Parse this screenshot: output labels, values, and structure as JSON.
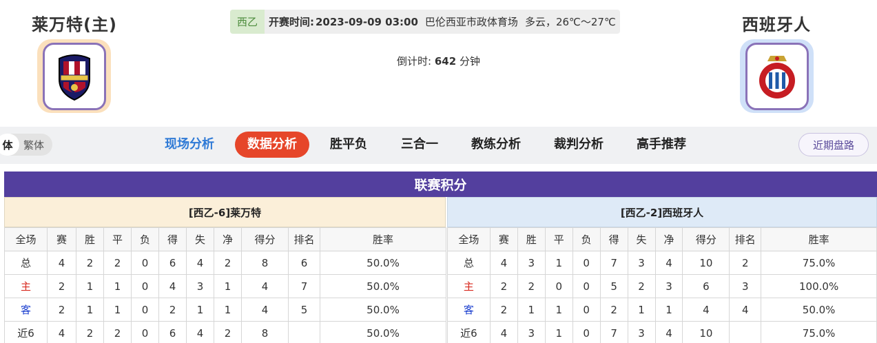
{
  "match": {
    "home_name": "莱万特(主)",
    "away_name": "西班牙人",
    "league": "西乙",
    "kickoff_label": "开赛时间:",
    "kickoff_time": "2023-09-09 03:00",
    "venue": "巴伦西亚市政体育场",
    "weather": "多云，26℃～27℃",
    "countdown_label": "倒计时:",
    "countdown_value": "642",
    "countdown_unit": "分钟"
  },
  "nav": {
    "lang_simplified": "简体",
    "lang_simplified_visible": "体",
    "lang_traditional": "繁体",
    "tabs": [
      "现场分析",
      "数据分析",
      "胜平负",
      "三合一",
      "教练分析",
      "裁判分析",
      "高手推荐"
    ],
    "recent_button": "近期盘路"
  },
  "standings": {
    "title": "联赛积分",
    "columns": [
      "全场",
      "赛",
      "胜",
      "平",
      "负",
      "得",
      "失",
      "净",
      "得分",
      "排名",
      "胜率"
    ],
    "home": {
      "header": "[西乙-6]莱万特",
      "rows": [
        [
          "总",
          "4",
          "2",
          "2",
          "0",
          "6",
          "4",
          "2",
          "8",
          "6",
          "50.0%"
        ],
        [
          "主",
          "2",
          "1",
          "1",
          "0",
          "4",
          "3",
          "1",
          "4",
          "7",
          "50.0%"
        ],
        [
          "客",
          "2",
          "1",
          "1",
          "0",
          "2",
          "1",
          "1",
          "4",
          "5",
          "50.0%"
        ],
        [
          "近6",
          "4",
          "2",
          "2",
          "0",
          "6",
          "4",
          "2",
          "8",
          "",
          "50.0%"
        ]
      ]
    },
    "away": {
      "header": "[西乙-2]西班牙人",
      "rows": [
        [
          "总",
          "4",
          "3",
          "1",
          "0",
          "7",
          "3",
          "4",
          "10",
          "2",
          "75.0%"
        ],
        [
          "主",
          "2",
          "2",
          "0",
          "0",
          "5",
          "2",
          "3",
          "6",
          "3",
          "100.0%"
        ],
        [
          "客",
          "2",
          "1",
          "1",
          "0",
          "2",
          "1",
          "1",
          "4",
          "4",
          "50.0%"
        ],
        [
          "近6",
          "4",
          "3",
          "1",
          "0",
          "7",
          "3",
          "4",
          "10",
          "",
          "75.0%"
        ]
      ]
    }
  },
  "colors": {
    "title_bar": "#533f9e",
    "active_tab": "#e6462a",
    "home_label": "#d7281d",
    "away_label": "#1b3fcf"
  }
}
